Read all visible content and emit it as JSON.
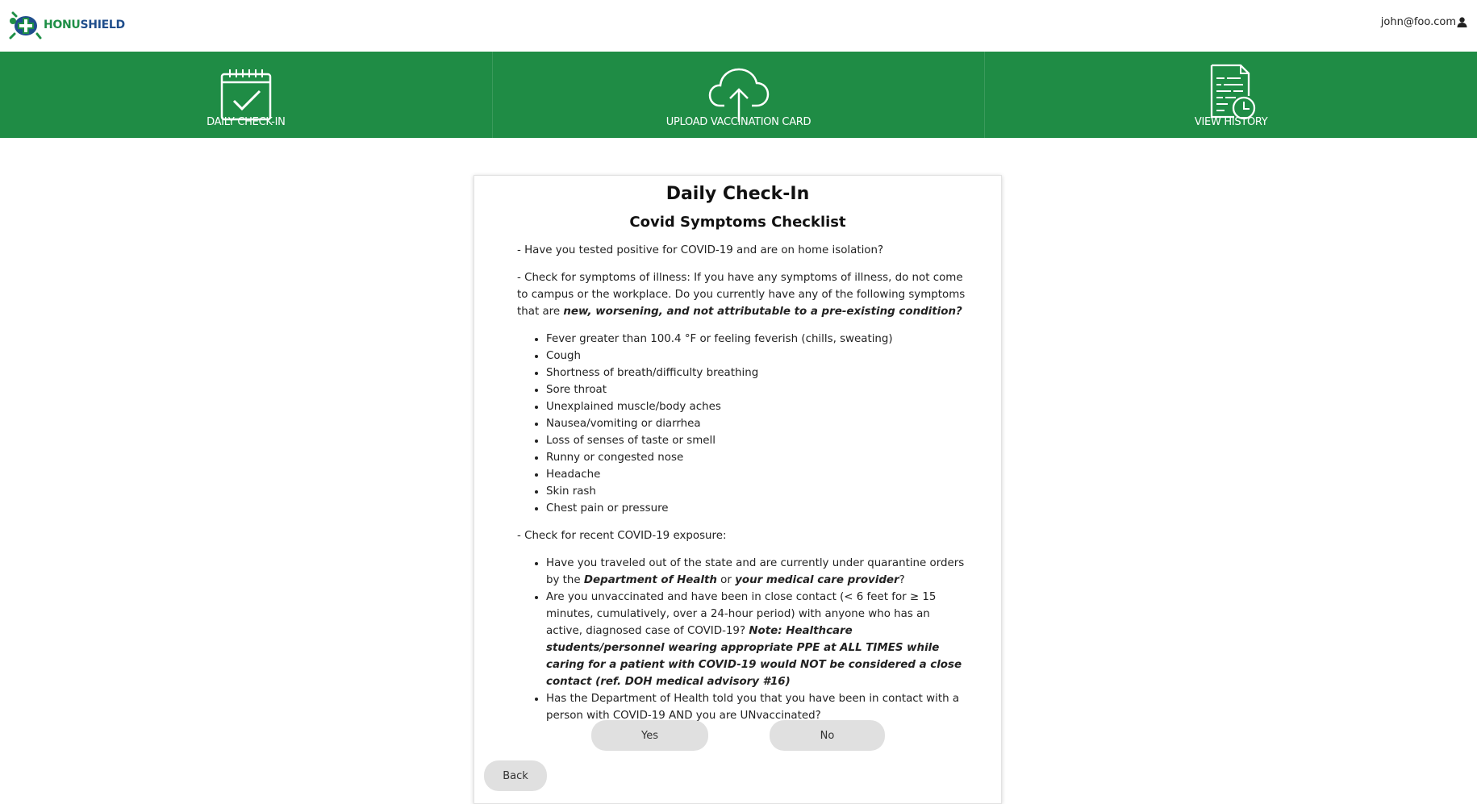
{
  "header": {
    "brand_a": "HONU",
    "brand_b": "SHIELD",
    "user_email": "john@foo.com"
  },
  "nav": {
    "items": [
      {
        "label": "DAILY CHECK-IN",
        "icon": "calendar-check-icon"
      },
      {
        "label": "UPLOAD VACCINATION CARD",
        "icon": "cloud-upload-icon"
      },
      {
        "label": "VIEW HISTORY",
        "icon": "document-clock-icon"
      }
    ]
  },
  "card": {
    "title": "Daily Check-In",
    "subtitle": "Covid Symptoms Checklist",
    "q1": "- Have you tested positive for COVID-19 and are on home isolation?",
    "q2_text": "- Check for symptoms of illness: If you have any symptoms of illness, do not come to campus or the workplace. Do you currently have any of the following symptoms that are ",
    "q2_emph": "new, worsening, and not attributable to a pre-existing condition?",
    "symptoms": [
      "Fever greater than 100.4 °F or feeling feverish (chills, sweating)",
      "Cough",
      "Shortness of breath/difficulty breathing",
      "Sore throat",
      "Unexplained muscle/body aches",
      "Nausea/vomiting or diarrhea",
      "Loss of senses of taste or smell",
      "Runny or congested nose",
      "Headache",
      "Skin rash",
      "Chest pain or pressure"
    ],
    "q3": "- Check for recent COVID-19 exposure:",
    "exposure": {
      "e1_a": "Have you traveled out of the state and are currently under quarantine orders by the ",
      "e1_b": "Department of Health",
      "e1_c": " or ",
      "e1_d": "your medical care provider",
      "e1_e": "?",
      "e2_a": "Are you unvaccinated and have been in close contact (< 6 feet for ≥ 15 minutes, cumulatively, over a 24-hour period) with anyone who has an active, diagnosed case of COVID-19? ",
      "e2_b": "Note: Healthcare students/personnel wearing appropriate PPE at ALL TIMES while caring for a patient with COVID-19 would NOT be considered a close contact (ref. DOH medical advisory #16)",
      "e3": "Has the Department of Health told you that you have been in contact with a person with COVID-19 AND you are UNvaccinated?"
    },
    "yes_label": "Yes",
    "no_label": "No",
    "back_label": "Back"
  },
  "colors": {
    "nav_green": "#1f8c45",
    "brand_green": "#1e8f46",
    "brand_blue": "#1f4e8c",
    "button_gray": "#e0e0e0"
  }
}
